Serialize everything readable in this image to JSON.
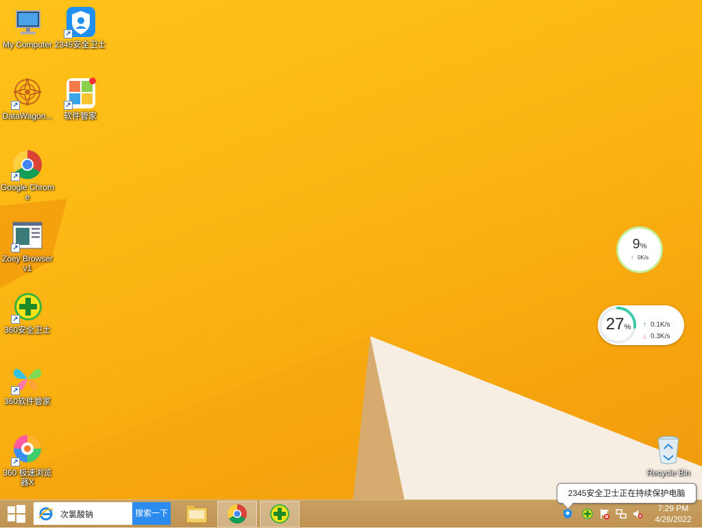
{
  "desktop": {
    "icons": [
      {
        "label": "My Computer",
        "icon": "computer-icon"
      },
      {
        "label": "2345安全卫士",
        "icon": "shield-user-icon"
      },
      {
        "label": "DataWagon...",
        "icon": "mandala-icon"
      },
      {
        "label": "软件管家",
        "icon": "software-manager-icon"
      },
      {
        "label": "Google Chrome",
        "icon": "chrome-icon"
      },
      {
        "label": "Zoey Browser v1",
        "icon": "browser-window-icon"
      },
      {
        "label": "360安全卫士",
        "icon": "plus-shield-icon"
      },
      {
        "label": "360软件管家",
        "icon": "butterfly-icon"
      },
      {
        "label": "360 极速浏览器X",
        "icon": "colorful-browser-icon"
      },
      {
        "label": "Recycle Bin",
        "icon": "recycle-bin-icon"
      }
    ]
  },
  "widgets": {
    "small": {
      "percent": "9",
      "unit": "%",
      "speed": "0K/s"
    },
    "large": {
      "percent": "27",
      "unit": "%",
      "upload": "0.1K/s",
      "download": "0.3K/s"
    }
  },
  "tooltip": {
    "text": "2345安全卫士正在持续保护电脑"
  },
  "taskbar": {
    "search_text": "次氯酸钠",
    "search_button": "搜索一下",
    "time": "7:29 PM",
    "date": "4/26/2022"
  },
  "colors": {
    "accent": "#2b8bef",
    "wallpaper": "#fbb512",
    "taskbar": "#c49a5a"
  }
}
